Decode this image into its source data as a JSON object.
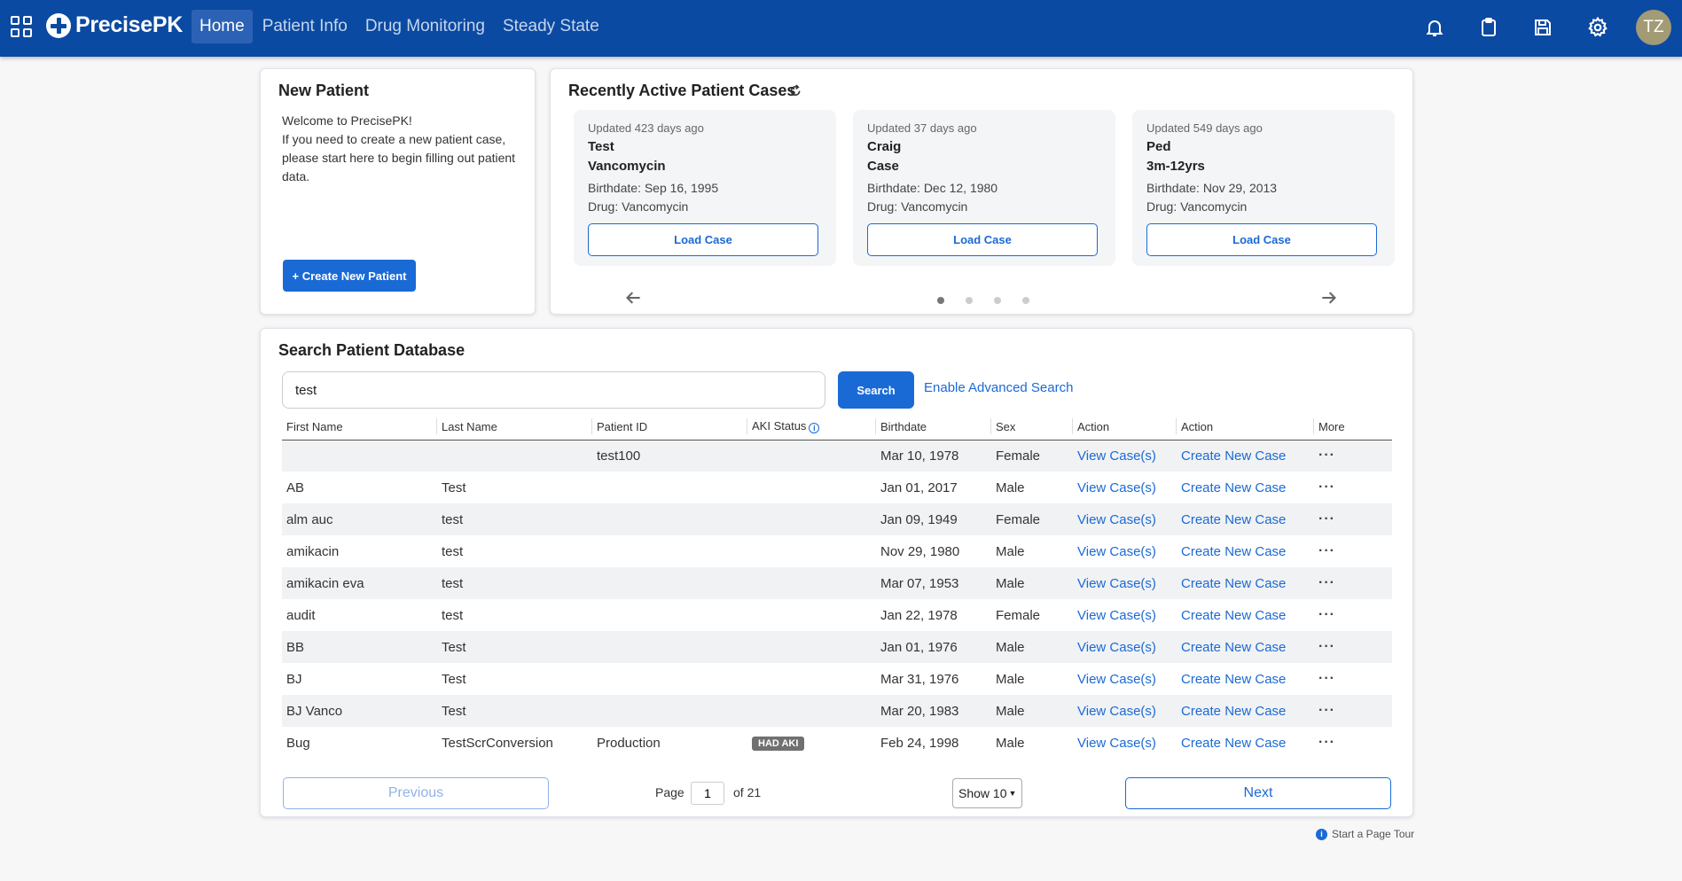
{
  "brand": {
    "name": "PrecisePK"
  },
  "nav": {
    "tabs": [
      {
        "label": "Home"
      },
      {
        "label": "Patient Info"
      },
      {
        "label": "Drug Monitoring"
      },
      {
        "label": "Steady State"
      }
    ],
    "active_tab": "Home",
    "icons": [
      "bell-icon",
      "clipboard-icon",
      "save-icon",
      "gear-icon"
    ],
    "avatar_initials": "TZ"
  },
  "new_patient": {
    "title": "New Patient",
    "welcome": "Welcome to PrecisePK!",
    "description": "If you need to create a new patient case, please start here to begin filling out patient data.",
    "create_button": "+ Create New Patient"
  },
  "recent_cases": {
    "title": "Recently Active Patient Cases",
    "cases": [
      {
        "updated": "Updated 423 days ago",
        "first": "Test",
        "last": "Vancomycin",
        "birthdate": "Birthdate: Sep 16, 1995",
        "drug": "Drug: Vancomycin",
        "button": "Load Case"
      },
      {
        "updated": "Updated 37 days ago",
        "first": "Craig",
        "last": "Case",
        "birthdate": "Birthdate: Dec 12, 1980",
        "drug": "Drug: Vancomycin",
        "button": "Load Case"
      },
      {
        "updated": "Updated 549 days ago",
        "first": "Ped",
        "last": "3m-12yrs",
        "birthdate": "Birthdate: Nov 29, 2013",
        "drug": "Drug: Vancomycin",
        "button": "Load Case"
      }
    ],
    "carousel_pages": 4,
    "active_page": 1
  },
  "search": {
    "title": "Search Patient Database",
    "query": "test",
    "search_button": "Search",
    "advanced_link": "Enable Advanced Search",
    "columns": [
      "First Name",
      "Last Name",
      "Patient ID",
      "AKI Status",
      "Birthdate",
      "Sex",
      "Action",
      "Action",
      "More"
    ],
    "rows": [
      {
        "first": "",
        "last": "",
        "patient_id": "test100",
        "aki": "",
        "birthdate": "Mar 10, 1978",
        "sex": "Female"
      },
      {
        "first": "AB",
        "last": "Test",
        "patient_id": "",
        "aki": "",
        "birthdate": "Jan 01, 2017",
        "sex": "Male"
      },
      {
        "first": "alm auc",
        "last": "test",
        "patient_id": "",
        "aki": "",
        "birthdate": "Jan 09, 1949",
        "sex": "Female"
      },
      {
        "first": "amikacin",
        "last": "test",
        "patient_id": "",
        "aki": "",
        "birthdate": "Nov 29, 1980",
        "sex": "Male"
      },
      {
        "first": "amikacin eva",
        "last": "test",
        "patient_id": "",
        "aki": "",
        "birthdate": "Mar 07, 1953",
        "sex": "Male"
      },
      {
        "first": "audit",
        "last": "test",
        "patient_id": "",
        "aki": "",
        "birthdate": "Jan 22, 1978",
        "sex": "Female"
      },
      {
        "first": "BB",
        "last": "Test",
        "patient_id": "",
        "aki": "",
        "birthdate": "Jan 01, 1976",
        "sex": "Male"
      },
      {
        "first": "BJ",
        "last": "Test",
        "patient_id": "",
        "aki": "",
        "birthdate": "Mar 31, 1976",
        "sex": "Male"
      },
      {
        "first": "BJ Vanco",
        "last": "Test",
        "patient_id": "",
        "aki": "",
        "birthdate": "Mar 20, 1983",
        "sex": "Male"
      },
      {
        "first": "Bug",
        "last": "TestScrConversion",
        "patient_id": "Production",
        "aki": "HAD AKI",
        "birthdate": "Feb 24, 1998",
        "sex": "Male"
      }
    ],
    "view_cases_label": "View Case(s)",
    "create_case_label": "Create New Case",
    "more_label": "···"
  },
  "pagination": {
    "previous": "Previous",
    "page_label": "Page",
    "page": "1",
    "of_label": "of 21",
    "show_label": "Show 10",
    "next": "Next"
  },
  "tour": {
    "label": "Start a Page Tour"
  },
  "colors": {
    "navbar": "#0b4aa2",
    "accent": "#1a6ad6",
    "badge": "#707070"
  }
}
